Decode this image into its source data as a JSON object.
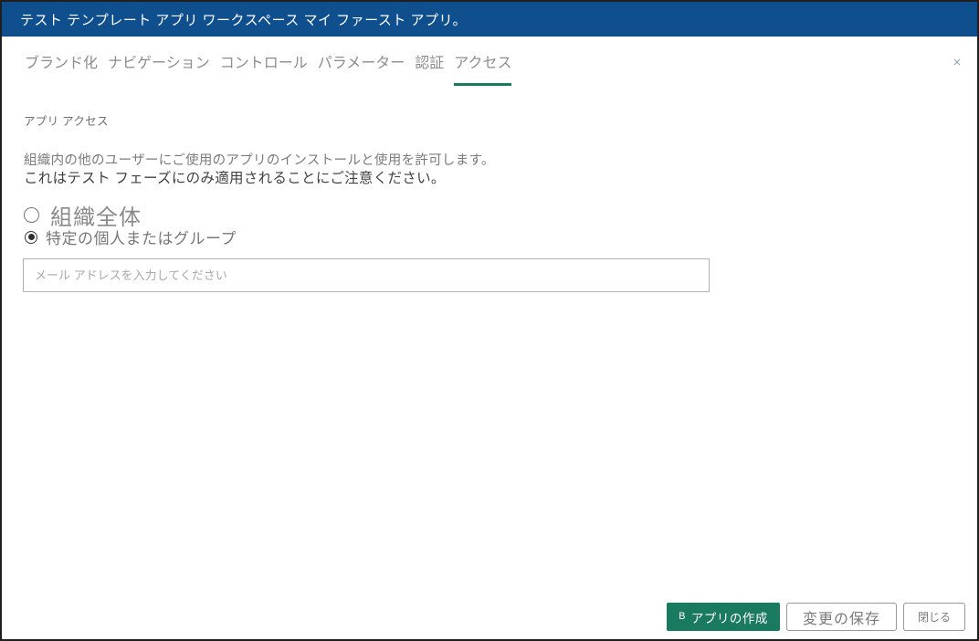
{
  "titlebar": {
    "title": "テスト テンプレート アプリ ワークスペース マイ ファースト アプリ。"
  },
  "tabs": [
    {
      "label": "ブランド化",
      "active": false
    },
    {
      "label": "ナビゲーション",
      "active": false
    },
    {
      "label": "コントロール",
      "active": false
    },
    {
      "label": "パラメーター",
      "active": false
    },
    {
      "label": "認証",
      "active": false
    },
    {
      "label": "アクセス",
      "active": true
    }
  ],
  "close_icon": "×",
  "section": {
    "heading": "アプリ アクセス",
    "description_line1": "組織内の他のユーザーにご使用のアプリのインストールと使用を許可します。",
    "description_line2": "これはテスト フェーズにのみ適用されることにご注意ください。"
  },
  "access_options": {
    "org_label": "組織全体",
    "specific_label": "特定の個人またはグループ",
    "selected_option": "specific"
  },
  "email_input": {
    "value": "",
    "placeholder": "メール アドレスを入力してください"
  },
  "footer": {
    "create_app_icon": "B",
    "create_app_label": "アプリの作成",
    "save_label": "変更の保存",
    "close_label": "閉じる"
  },
  "colors": {
    "titlebar_bg": "#104F8D",
    "accent_teal": "#177A5F",
    "primary_button_bg": "#1A7A5F",
    "tab_text": "#8c8c8c",
    "frame_border": "#1f1f1f"
  }
}
